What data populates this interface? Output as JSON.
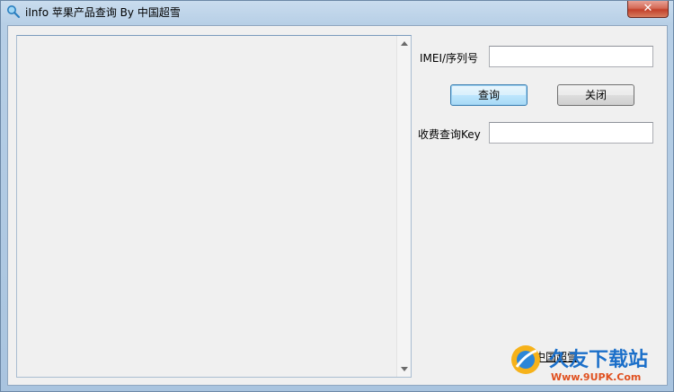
{
  "window": {
    "title": "iInfo 苹果产品查询 By 中国超雪",
    "close_glyph": "✕"
  },
  "form": {
    "imei_label": "IMEI/序列号",
    "imei_value": "",
    "query_button": "查询",
    "close_button": "关闭",
    "key_label": "收费查询Key",
    "key_value": ""
  },
  "footer": {
    "link_text": "中国超雪"
  },
  "watermark": {
    "title": "久友下载站",
    "url": "Www.9UPK.Com"
  },
  "colors": {
    "watermark_blue": "#1b6fc9",
    "watermark_orange": "#e0501f"
  }
}
